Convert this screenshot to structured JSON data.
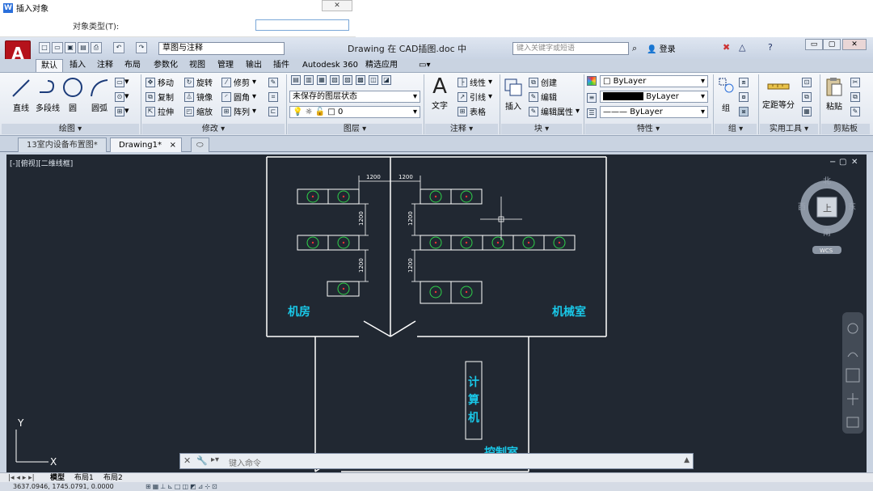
{
  "dialog": {
    "title": "插入对象",
    "object_type_label": "对象类型(T):"
  },
  "app": {
    "logo": "A",
    "workspace": "草图与注释",
    "doc_title": "Drawing 在 CAD插图.doc 中",
    "search_placeholder": "键入关键字或短语",
    "login": "登录",
    "window_buttons": {
      "min": "▭",
      "restore": "▢",
      "close": "✕"
    }
  },
  "tabs": [
    "默认",
    "插入",
    "注释",
    "布局",
    "参数化",
    "视图",
    "管理",
    "输出",
    "插件",
    "Autodesk 360",
    "精选应用"
  ],
  "ribbon": {
    "draw": {
      "title": "绘图 ▾",
      "line": "直线",
      "polyline": "多段线",
      "circle": "圆",
      "arc": "圆弧"
    },
    "modify": {
      "title": "修改 ▾",
      "move": "移动",
      "rotate": "旋转",
      "trim": "修剪",
      "copy": "复制",
      "mirror": "镜像",
      "fillet": "圆角",
      "stretch": "拉伸",
      "scale": "缩放",
      "array": "阵列"
    },
    "layers": {
      "title": "图层 ▾",
      "state": "未保存的图层状态",
      "layer": "0"
    },
    "annotation": {
      "title": "注释 ▾",
      "text": "文字",
      "linear": "线性",
      "leader": "引线",
      "table": "表格"
    },
    "block": {
      "title": "块 ▾",
      "insert": "插入",
      "create": "创建",
      "edit": "编辑",
      "edit_attr": "编辑属性"
    },
    "properties": {
      "title": "特性 ▾",
      "color": "ByLayer",
      "linetype": "ByLayer",
      "lineweight": "ByLayer"
    },
    "groups": {
      "title": "组 ▾",
      "group": "组"
    },
    "utilities": {
      "title": "实用工具 ▾",
      "measure": "定距等分"
    },
    "clipboard": {
      "title": "剪贴板",
      "paste": "粘贴"
    }
  },
  "doc_tabs": [
    "13室内设备布置图*",
    "Drawing1*"
  ],
  "viewport": {
    "label": "[-][俯视][二维线框]",
    "compass": {
      "n": "北",
      "s": "南",
      "e": "东",
      "w": "西",
      "top": "上",
      "wcs": "WCS"
    }
  },
  "drawing": {
    "room_left": "机房",
    "room_right": "机械室",
    "computer": [
      "计",
      "算",
      "机"
    ],
    "control_room": "控制室",
    "dims": [
      "1200",
      "1200",
      "1200",
      "1200",
      "1200",
      "1200"
    ],
    "axis_y": "Y",
    "axis_x": "X"
  },
  "command": {
    "placeholder": "键入命令"
  },
  "layout_tabs": [
    "模型",
    "布局1",
    "布局2"
  ],
  "status": {
    "coords": "3637.0946, 1745.0791, 0.0000"
  }
}
